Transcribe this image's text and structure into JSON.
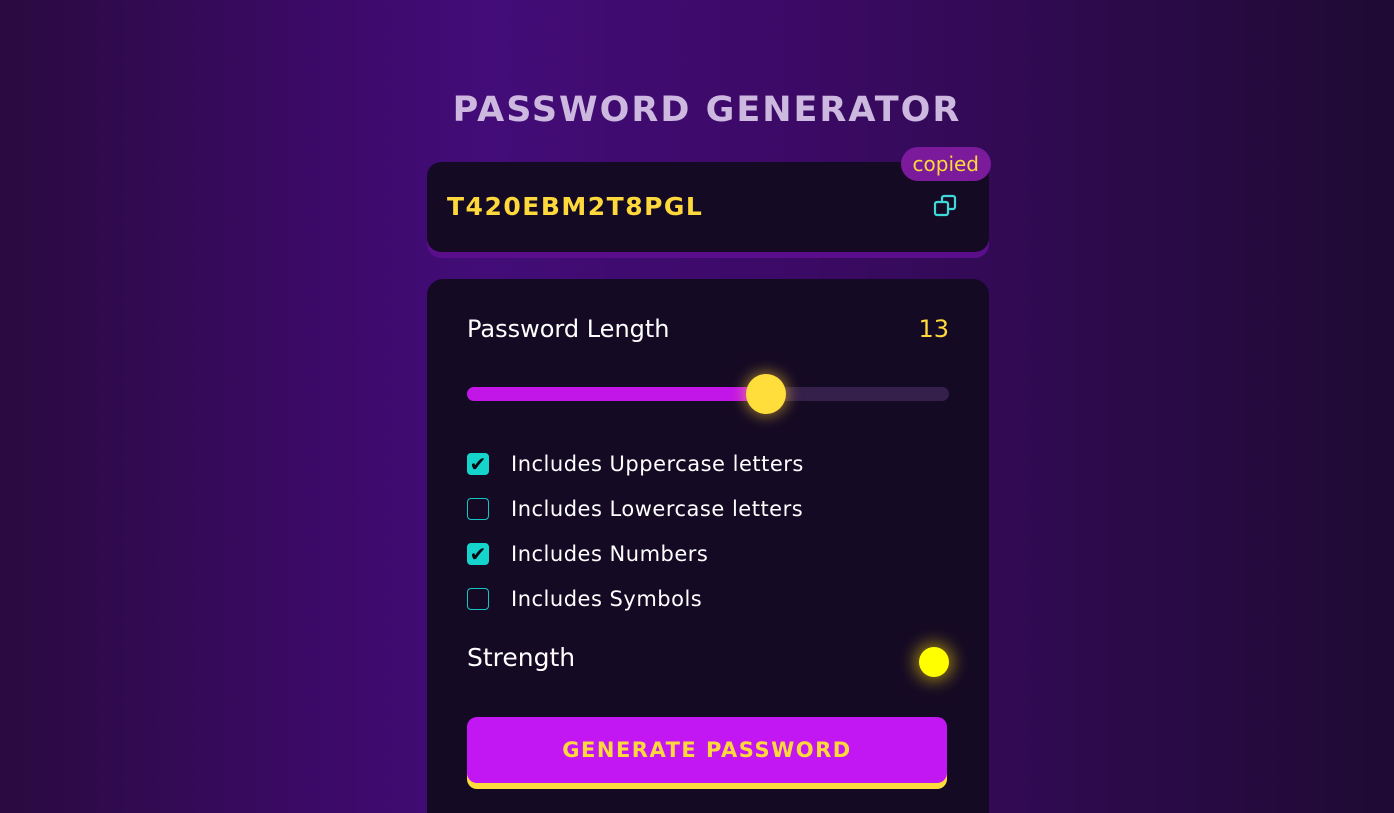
{
  "app": {
    "title": "PASSWORD GENERATOR"
  },
  "password": {
    "value": "T420EBM2T8PGL",
    "copied_label": "copied",
    "copy_icon": "copy-icon"
  },
  "length": {
    "label": "Password Length",
    "value": "13",
    "slider_fraction": 0.62
  },
  "options": [
    {
      "label": "Includes Uppercase letters",
      "checked": true
    },
    {
      "label": "Includes Lowercase letters",
      "checked": false
    },
    {
      "label": "Includes Numbers",
      "checked": true
    },
    {
      "label": "Includes Symbols",
      "checked": false
    }
  ],
  "strength": {
    "label": "Strength",
    "indicator_color": "#ffff00"
  },
  "generate_button": {
    "label": "GENERATE PASSWORD"
  },
  "colors": {
    "accent": "#c216f2",
    "highlight": "#ffd93b",
    "checkbox": "#15d4cc"
  }
}
